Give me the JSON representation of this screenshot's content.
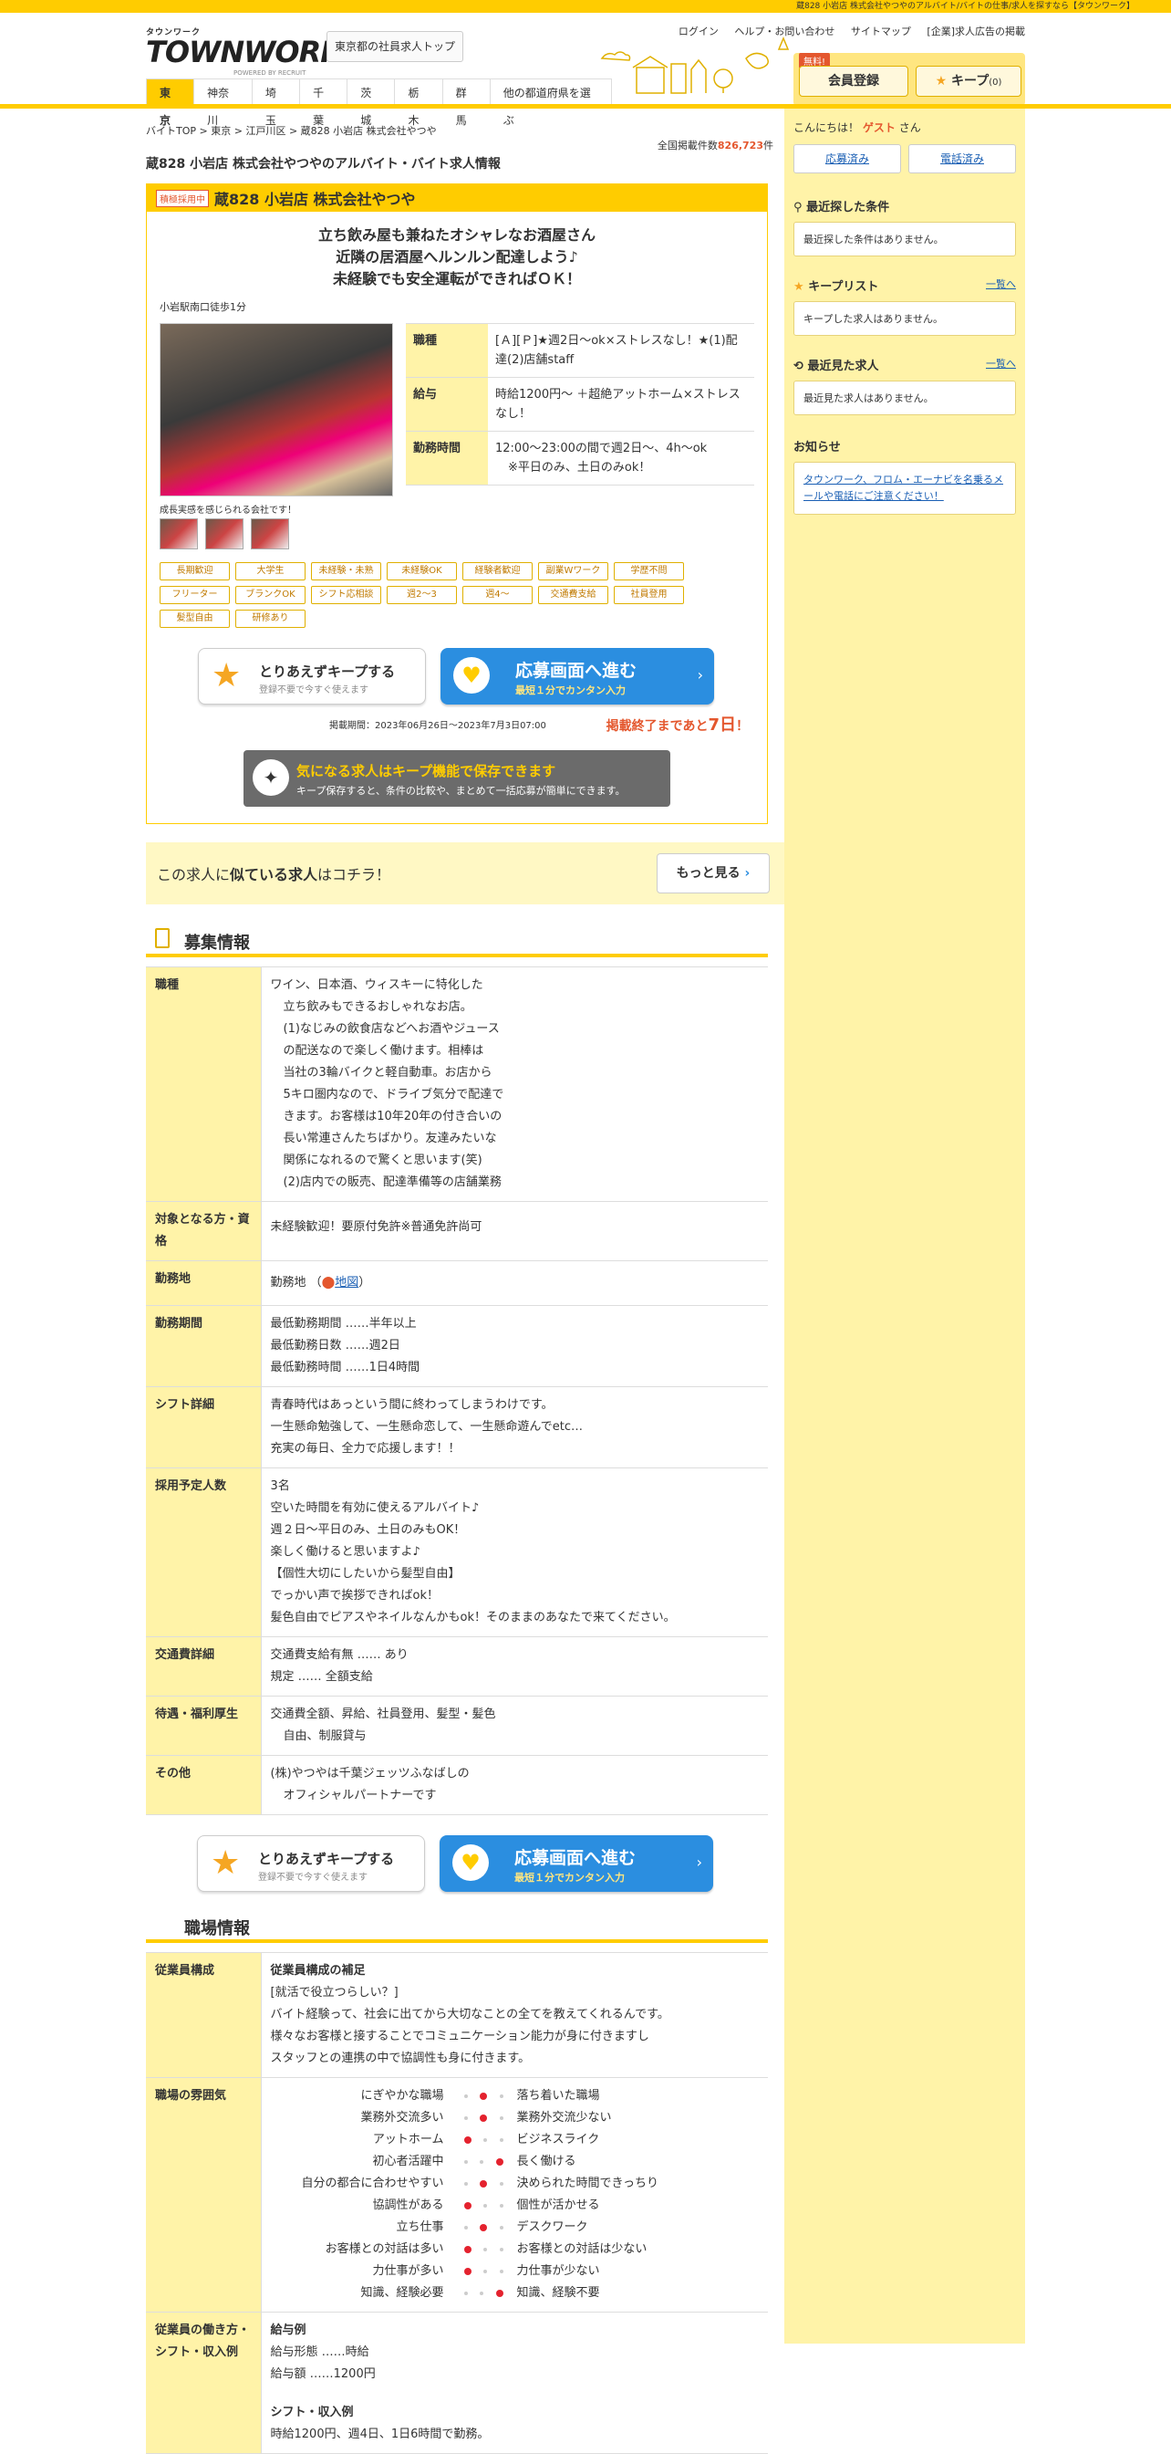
{
  "topbar": {
    "text": "蔵828 小岩店 株式会社やつやのアルバイト/バイトの仕事/求人を探すなら【タウンワーク】"
  },
  "header": {
    "logo_small": "タウンワーク",
    "logo_big": "TOWNWORK",
    "logo_powered": "POWERED BY RECRUIT",
    "trop_button": "東京都の社員求人トップ",
    "links": [
      "ログイン",
      "ヘルプ・お問い合わせ",
      "サイトマップ",
      "[企業]求人広告の掲載"
    ],
    "free_badge": "無料!",
    "register": "会員登録",
    "keep": "キープ",
    "keep_count": "(0)"
  },
  "nav": [
    "東京",
    "神奈川",
    "埼玉",
    "千葉",
    "茨城",
    "栃木",
    "群馬",
    "他の都道府県を選ぶ"
  ],
  "breadcrumb": [
    "バイトTOP",
    "東京",
    "江戸川区",
    "蔵828 小岩店 株式会社やつや"
  ],
  "total": {
    "label": "全国掲載件数",
    "count": "826,723",
    "unit": "件"
  },
  "page_title": "蔵828 小岩店 株式会社やつやのアルバイト・バイト求人情報",
  "job": {
    "badge": "積極採用中",
    "name": "蔵828 小岩店 株式会社やつや",
    "catch": [
      "立ち飲み屋も兼ねたオシャレなお酒屋さん",
      "近隣の居酒屋へルンルン配達しよう♪",
      "未経験でも安全運転ができればＯＫ！"
    ],
    "station": "小岩駅南口徒歩1分",
    "photo_caption": "成長実感を感じられる会社です！",
    "info": [
      {
        "k": "職種",
        "v": "[Ａ][Ｐ]★週2日〜ok×ストレスなし！★(1)配達(2)店舗staff"
      },
      {
        "k": "給与",
        "v": "時給1200円〜 ＋超絶アットホーム×ストレスなし！"
      },
      {
        "k": "勤務時間",
        "v": "12:00〜23:00の間で週2日〜、4h〜ok",
        "v2": "※平日のみ、土日のみok！"
      }
    ],
    "tags": [
      "長期歓迎",
      "大学生",
      "未経験・未熟",
      "未経験OK",
      "経験者歓迎",
      "副業Wワーク",
      "学歴不問",
      "フリーター",
      "ブランクOK",
      "シフト応相談",
      "週2〜3",
      "週4〜",
      "交通費支給",
      "社員登用",
      "髪型自由",
      "研修あり"
    ]
  },
  "cta": {
    "keep_title": "とりあえずキープする",
    "keep_sub": "登録不要で今すぐ使えます",
    "apply_title": "応募画面へ進む",
    "apply_sub": "最短１分でカンタン入力"
  },
  "period": {
    "text": "掲載期間：2023年06月26日〜2023年7月3日07:00",
    "end_prefix": "掲載終了まであと",
    "end_days": "7日",
    "end_suffix": "！"
  },
  "keep_banner": {
    "title": "気になる求人はキープ機能で保存できます",
    "sub": "キープ保存すると、条件の比較や、まとめて一括応募が簡単にできます。"
  },
  "similar": {
    "pre": "この求人に",
    "bold": "似ている求人",
    "post": "はコチラ！",
    "button": "もっと見る"
  },
  "recruit": {
    "heading": "募集情報",
    "rows": [
      {
        "k": "職種",
        "lines": [
          "ワイン、日本酒、ウィスキーに特化した",
          "立ち飲みもできるおしゃれなお店。",
          "(1)なじみの飲食店などへお酒やジュース",
          "の配送なので楽しく働けます。相棒は",
          "当社の3輪バイクと軽自動車。お店から",
          "5キロ圏内なので、ドライブ気分で配達で",
          "きます。お客様は10年20年の付き合いの",
          "長い常連さんたちばかり。友達みたいな",
          "関係になれるので驚くと思います(笑)",
          "(2)店内での販売、配達準備等の店舗業務"
        ]
      },
      {
        "k": "対象となる方・資格",
        "lines": [
          "未経験歓迎！要原付免許※普通免許尚可"
        ]
      },
      {
        "k": "勤務地",
        "lines": [
          "勤務地"
        ],
        "map": "地図"
      },
      {
        "k": "勤務期間",
        "lines": [
          "最低勤務期間 ……半年以上",
          "最低勤務日数 ……週2日",
          "最低勤務時間 ……1日4時間"
        ]
      },
      {
        "k": "シフト詳細",
        "lines": [
          "青春時代はあっという間に終わってしまうわけです。",
          "一生懸命勉強して、一生懸命恋して、一生懸命遊んでetc…",
          "充実の毎日、全力で応援します！！"
        ]
      },
      {
        "k": "採用予定人数",
        "lines": [
          "3名",
          "空いた時間を有効に使えるアルバイト♪",
          "週２日〜平日のみ、土日のみもOK！",
          "楽しく働けると思いますよ♪",
          "【個性大切にしたいから髪型自由】",
          "でっかい声で挨拶できればok！",
          "髪色自由でピアスやネイルなんかもok！そのままのあなたで来てください。"
        ]
      },
      {
        "k": "交通費詳細",
        "lines": [
          "交通費支給有無 …… あり",
          "規定 …… 全額支給"
        ]
      },
      {
        "k": "待遇・福利厚生",
        "lines": [
          "交通費全額、昇給、社員登用、髪型・髪色",
          "自由、制服貸与"
        ]
      },
      {
        "k": "その他",
        "lines": [
          "(株)やつやは千葉ジェッツふなばしの",
          "オフィシャルパートナーです"
        ]
      }
    ]
  },
  "workplace": {
    "heading": "職場情報",
    "staff_k": "従業員構成",
    "staff_title": "従業員構成の補足",
    "staff_lines": [
      "[就活で役立つらしい？]",
      "バイト経験って、社会に出てから大切なことの全てを教えてくれるんです。",
      "様々なお客様と接することでコミュニケーション能力が身に付きますし",
      "スタッフとの連携の中で協調性も身に付きます。"
    ],
    "mood_k": "職場の雰囲気",
    "mood": [
      {
        "l": "にぎやかな職場",
        "r": "落ち着いた職場",
        "pos": 1
      },
      {
        "l": "業務外交流多い",
        "r": "業務外交流少ない",
        "pos": 1
      },
      {
        "l": "アットホーム",
        "r": "ビジネスライク",
        "pos": 0
      },
      {
        "l": "初心者活躍中",
        "r": "長く働ける",
        "pos": 2
      },
      {
        "l": "自分の都合に合わせやすい",
        "r": "決められた時間できっちり",
        "pos": 1
      },
      {
        "l": "協調性がある",
        "r": "個性が活かせる",
        "pos": 0
      },
      {
        "l": "立ち仕事",
        "r": "デスクワーク",
        "pos": 1
      },
      {
        "l": "お客様との対話は多い",
        "r": "お客様との対話は少ない",
        "pos": 0
      },
      {
        "l": "力仕事が多い",
        "r": "力仕事が少ない",
        "pos": 0
      },
      {
        "l": "知識、経験必要",
        "r": "知識、経験不要",
        "pos": 2
      }
    ],
    "income_k": "従業員の働き方・シフト・収入例",
    "income_title": "給与例",
    "income_lines": [
      "給与形態 ……時給",
      "給与額 ……1200円"
    ],
    "shift_title": "シフト・収入例",
    "shift_line": "時給1200円、週4日、1日6時間で勤務。"
  },
  "sidebar": {
    "greeting_pre": "こんにちは！",
    "guest": "ゲスト",
    "greeting_post": "さん",
    "btn_applied": "応募済み",
    "btn_called": "電話済み",
    "recent_search": "最近探した条件",
    "recent_search_empty": "最近探した条件はありません。",
    "keep_list": "キープリスト",
    "more": "一覧へ",
    "keep_empty": "キープした求人はありません。",
    "recent_view": "最近見た求人",
    "recent_view_empty": "最近見た求人はありません。",
    "notice": "お知らせ",
    "notice_link": "タウンワーク、フロム・エーナビを名乗るメールや電話にご注意ください！"
  },
  "colors": {
    "brand_yellow": "#ffcc00",
    "apply_blue": "#2b8ee0",
    "accent_red": "#e4572e"
  }
}
